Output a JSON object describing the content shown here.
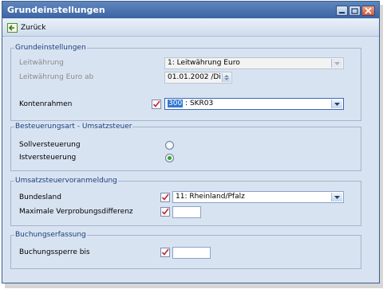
{
  "window": {
    "title": "Grundeinstellungen"
  },
  "toolbar": {
    "back_label": "Zurück"
  },
  "groups": {
    "grund": {
      "legend": "Grundeinstellungen",
      "leitwaehrung_label": "Leitwährung",
      "leitwaehrung_value": "1: Leitwährung Euro",
      "euro_ab_label": "Leitwährung Euro ab",
      "euro_ab_value": "01.01.2002 /Di",
      "kontenrahmen_label": "Kontenrahmen",
      "kontenrahmen_code": "300",
      "kontenrahmen_rest": " : SKR03"
    },
    "besteuerung": {
      "legend": "Besteuerungsart - Umsatzsteuer",
      "soll_label": "Sollversteuerung",
      "ist_label": "Istversteuerung"
    },
    "ustva": {
      "legend": "Umsatzsteuervoranmeldung",
      "bundesland_label": "Bundesland",
      "bundesland_value": "11: Rheinland/Pfalz",
      "verprobung_label": "Maximale Verprobungsdifferenz",
      "verprobung_value": ""
    },
    "buchung": {
      "legend": "Buchungserfassung",
      "sperre_label": "Buchungssperre bis",
      "sperre_value": ""
    }
  },
  "colors": {
    "title_bar": "#3b64a3",
    "legend_text": "#1c3f7a",
    "selection": "#3478d0",
    "radio_on": "#2fa52f"
  }
}
